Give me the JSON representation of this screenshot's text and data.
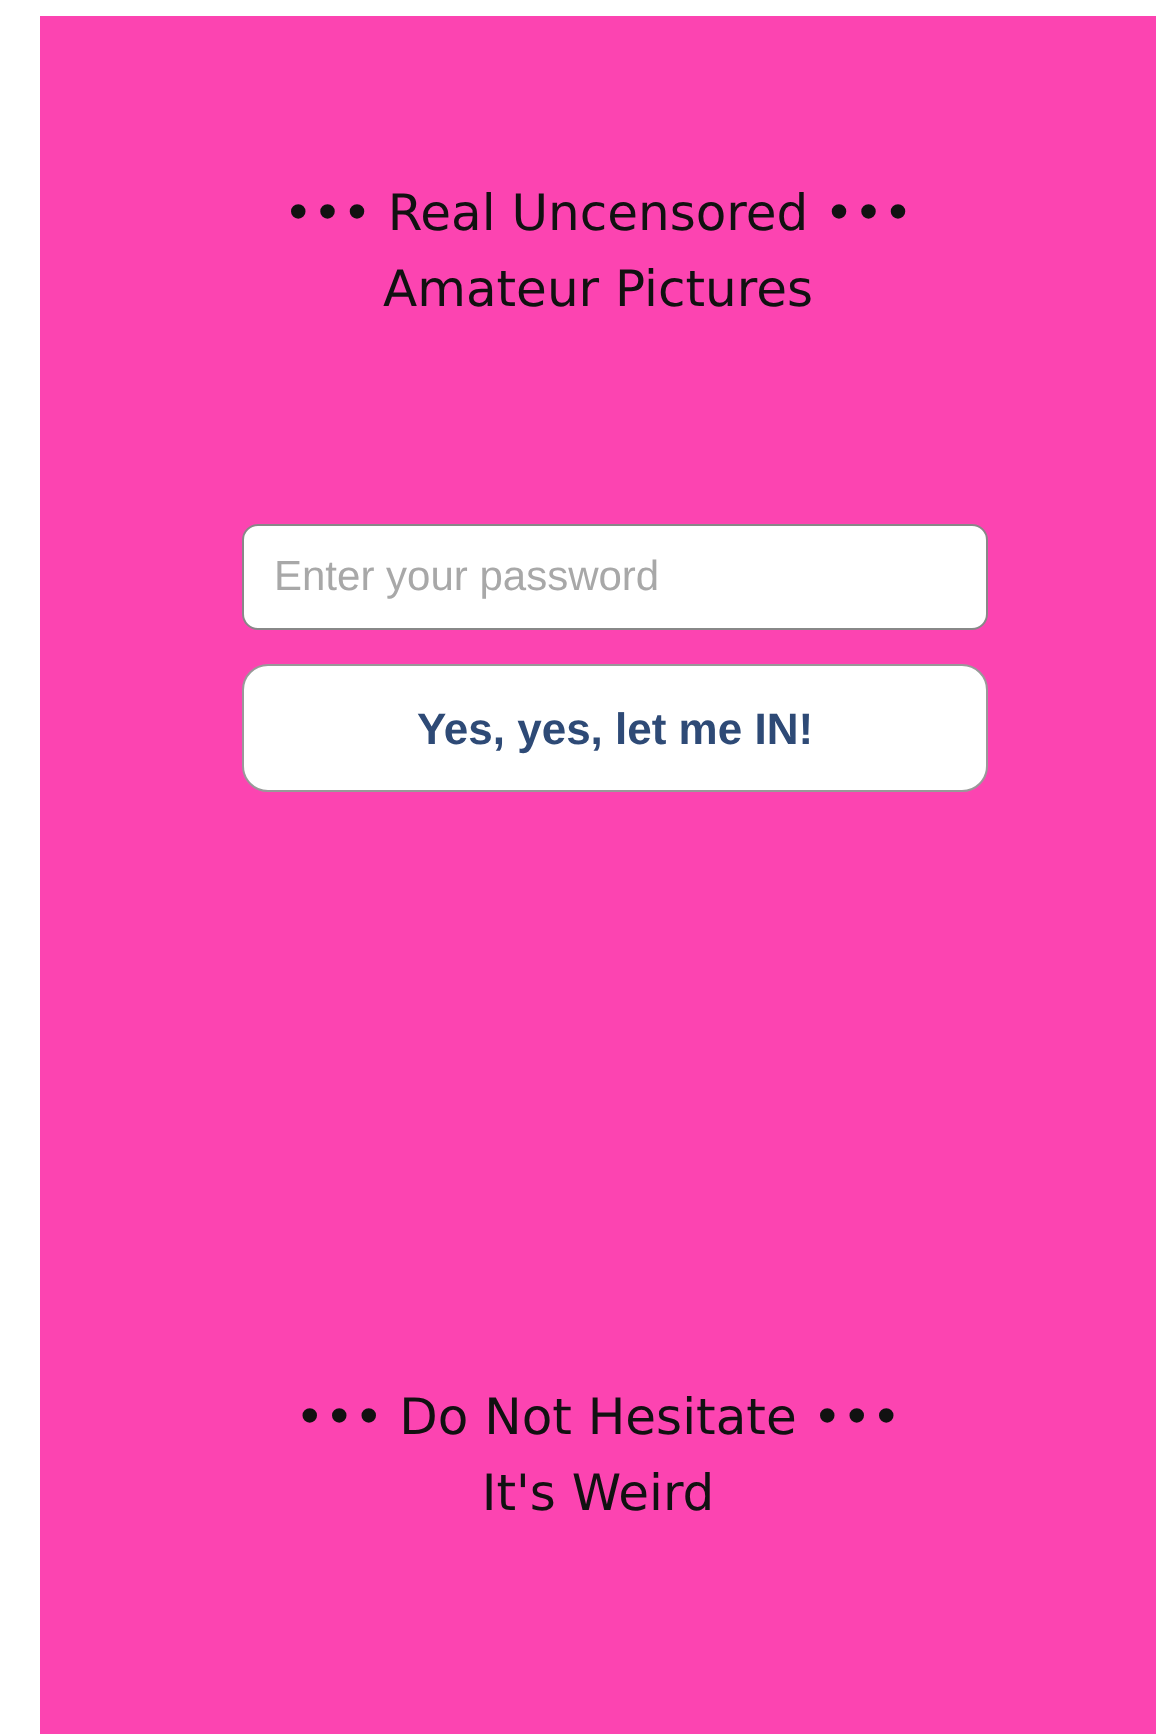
{
  "header": {
    "lines": [
      "••• Real Uncensored •••",
      "Amateur Pictures"
    ]
  },
  "password": {
    "placeholder": "Enter your password"
  },
  "submit": {
    "label": "Yes, yes, let me IN!"
  },
  "footer": {
    "lines": [
      "••• Do Not Hesitate •••",
      "It's Weird"
    ]
  }
}
